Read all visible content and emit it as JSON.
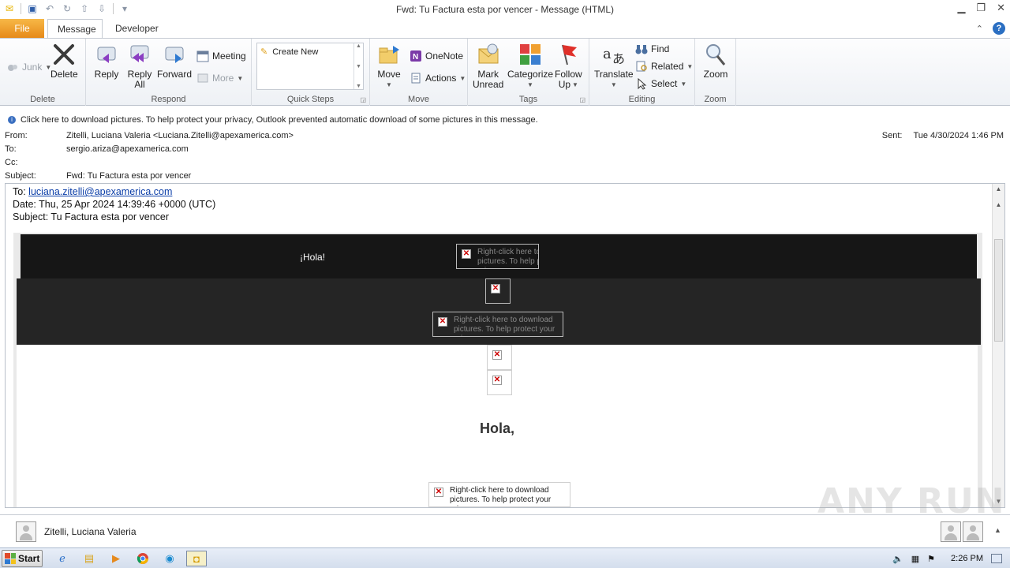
{
  "window": {
    "title": "Fwd: Tu Factura esta por vencer  -  Message (HTML)"
  },
  "tabs": [
    {
      "label": "File"
    },
    {
      "label": "Message"
    },
    {
      "label": "Developer"
    }
  ],
  "ribbon": {
    "delete_group": {
      "label": "Delete",
      "junk": "Junk",
      "delete": "Delete"
    },
    "respond_group": {
      "label": "Respond",
      "reply": "Reply",
      "reply_all_1": "Reply",
      "reply_all_2": "All",
      "forward": "Forward",
      "meeting": "Meeting",
      "more": "More"
    },
    "quick_steps_group": {
      "label": "Quick Steps",
      "create_new": "Create New"
    },
    "move_group": {
      "label": "Move",
      "move": "Move",
      "onenote": "OneNote",
      "actions": "Actions"
    },
    "tags_group": {
      "label": "Tags",
      "mark_unread_1": "Mark",
      "mark_unread_2": "Unread",
      "categorize": "Categorize",
      "follow_up_1": "Follow",
      "follow_up_2": "Up"
    },
    "editing_group": {
      "label": "Editing",
      "translate": "Translate",
      "find": "Find",
      "related": "Related",
      "select": "Select"
    },
    "zoom_group": {
      "label": "Zoom",
      "zoom": "Zoom"
    }
  },
  "infobar": {
    "text": "Click here to download pictures. To help protect your privacy, Outlook prevented automatic download of some pictures in this message."
  },
  "headers": {
    "from_label": "From:",
    "from_value": "Zitelli, Luciana Valeria <Luciana.Zitelli@apexamerica.com>",
    "to_label": "To:",
    "to_value": "sergio.ariza@apexamerica.com",
    "cc_label": "Cc:",
    "cc_value": "",
    "subject_label": "Subject:",
    "subject_value": "Fwd: Tu Factura esta por vencer",
    "sent_label": "Sent:",
    "sent_value": "Tue 4/30/2024 1:46 PM"
  },
  "body": {
    "fwd_to_label": "To:",
    "fwd_to_link": "luciana.zitelli@apexamerica.com",
    "fwd_date": "Date: Thu, 25 Apr 2024 14:39:46 +0000 (UTC)",
    "fwd_subject": "Subject: Tu Factura esta por vencer",
    "hola_small": "¡Hola!",
    "hola_big": "Hola,",
    "placeholder_1": "Right-click here to download pictures. To help protect your privacy...",
    "placeholder_2": "Right-click here to download pictures. To help protect your privacy...",
    "placeholder_3": "Right-click here to download pictures. To help protect your privacy..."
  },
  "people_pane": {
    "name": "Zitelli, Luciana Valeria"
  },
  "taskbar": {
    "start": "Start",
    "clock": "2:26 PM"
  },
  "watermark": "ANY RUN"
}
